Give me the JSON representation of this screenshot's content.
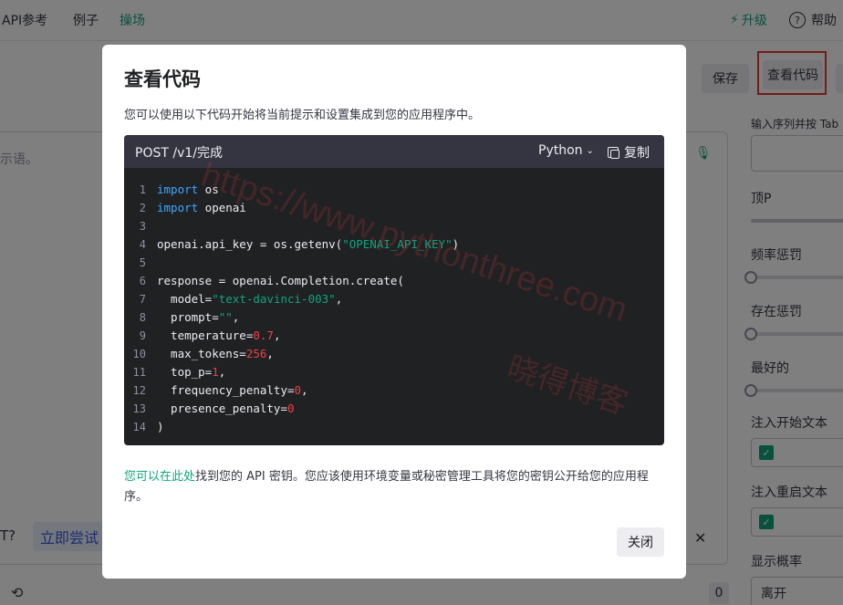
{
  "nav": {
    "items": [
      "API参考",
      "例子",
      "操场"
    ],
    "upgrade": "升级",
    "help": "帮助",
    "help_glyph": "?"
  },
  "toolbar": {
    "save": "保存",
    "view_code": "查看代码"
  },
  "editor": {
    "placeholder_tail": "示语。",
    "try_question": "T?",
    "try_now": "立即尝试",
    "history_count": "0"
  },
  "sidebar": {
    "stop_sequence_hint": "输入序列并按 Tab",
    "top_p": "顶P",
    "frequency_penalty": "频率惩罚",
    "presence_penalty": "存在惩罚",
    "best_of": "最好的",
    "inject_start": "注入开始文本",
    "inject_restart": "注入重启文本",
    "show_probabilities": "显示概率",
    "probabilities_value": "离开",
    "inject_start_checked": true,
    "inject_restart_checked": true
  },
  "modal": {
    "title": "查看代码",
    "description": "您可以使用以下代码开始将当前提示和设置集成到您的应用程序中。",
    "endpoint": "POST /v1/完成",
    "language": "Python",
    "copy": "复制",
    "code_lines": [
      [
        {
          "t": "kw",
          "v": "import"
        },
        {
          "t": "p",
          "v": " os"
        }
      ],
      [
        {
          "t": "kw",
          "v": "import"
        },
        {
          "t": "p",
          "v": " openai"
        }
      ],
      [],
      [
        {
          "t": "p",
          "v": "openai.api_key = os.getenv("
        },
        {
          "t": "str",
          "v": "\"OPENAI_API_KEY\""
        },
        {
          "t": "p",
          "v": ")"
        }
      ],
      [],
      [
        {
          "t": "p",
          "v": "response = openai.Completion.create("
        }
      ],
      [
        {
          "t": "p",
          "v": "  model="
        },
        {
          "t": "str",
          "v": "\"text-davinci-003\""
        },
        {
          "t": "p",
          "v": ","
        }
      ],
      [
        {
          "t": "p",
          "v": "  prompt="
        },
        {
          "t": "str",
          "v": "\"\""
        },
        {
          "t": "p",
          "v": ","
        }
      ],
      [
        {
          "t": "p",
          "v": "  temperature="
        },
        {
          "t": "num",
          "v": "0.7"
        },
        {
          "t": "p",
          "v": ","
        }
      ],
      [
        {
          "t": "p",
          "v": "  max_tokens="
        },
        {
          "t": "num",
          "v": "256"
        },
        {
          "t": "p",
          "v": ","
        }
      ],
      [
        {
          "t": "p",
          "v": "  top_p="
        },
        {
          "t": "num",
          "v": "1"
        },
        {
          "t": "p",
          "v": ","
        }
      ],
      [
        {
          "t": "p",
          "v": "  frequency_penalty="
        },
        {
          "t": "num",
          "v": "0"
        },
        {
          "t": "p",
          "v": ","
        }
      ],
      [
        {
          "t": "p",
          "v": "  presence_penalty="
        },
        {
          "t": "num",
          "v": "0"
        }
      ],
      [
        {
          "t": "p",
          "v": ")"
        }
      ]
    ],
    "footer_link": "您可以在此处",
    "footer_text": "找到您的 API 密钥。您应该使用环境变量或秘密管理工具将您的密钥公开给您的应用程序。",
    "close": "关闭"
  },
  "watermark": {
    "url": "https://www.pythonthree.com",
    "name": "晓得博客"
  },
  "colors": {
    "accent": "#10a37f",
    "highlight_box": "#e53935",
    "code_bg": "#202123",
    "keyword": "#3da8ff",
    "number": "#ef4146"
  }
}
